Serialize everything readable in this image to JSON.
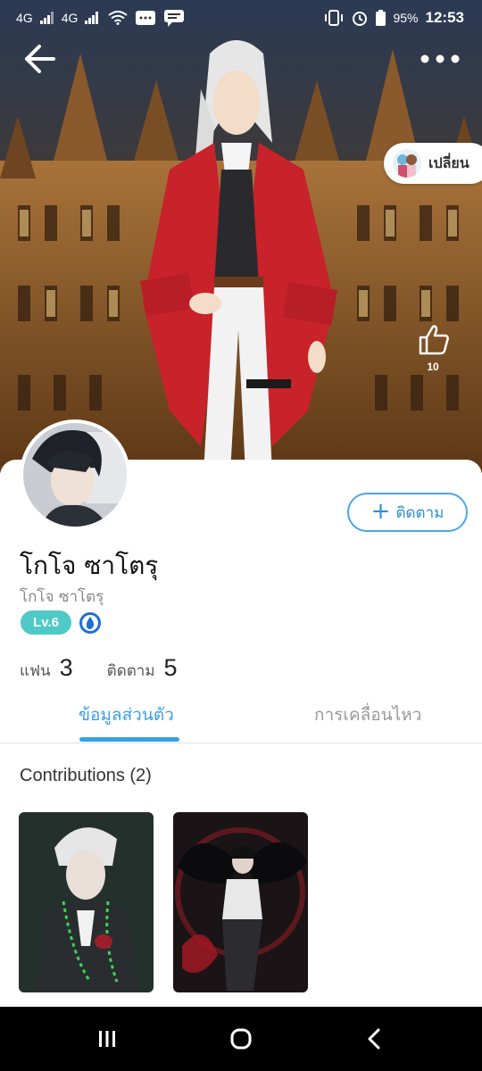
{
  "status_bar": {
    "network_left": "4G",
    "network_right": "4G",
    "battery": "95%",
    "time": "12:53"
  },
  "header": {
    "back_icon": "back-arrow-icon",
    "more_icon": "more-horizontal-icon",
    "change_label": "เปลี่ยน",
    "like_count": "10"
  },
  "profile": {
    "name": "โกโจ ซาโตรุ",
    "subname": "โกโจ ซาโตรุ",
    "level": "Lv.6",
    "follow_label": "ติดตาม",
    "fans_label": "แฟน",
    "fans_count": "3",
    "following_label": "ติดตาม",
    "following_count": "5"
  },
  "tabs": [
    {
      "label": "ข้อมูลส่วนตัว",
      "active": true
    },
    {
      "label": "การเคลื่อนไหว",
      "active": false
    }
  ],
  "contributions": {
    "title": "Contributions (2)"
  },
  "colors": {
    "accent": "#3aa0e6",
    "level_badge": "#4ec9c5"
  }
}
